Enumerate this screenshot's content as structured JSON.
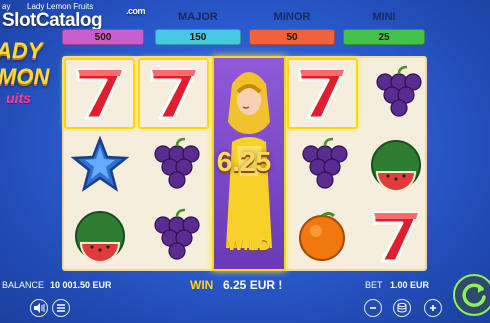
{
  "topbar": {
    "left_text": "ay",
    "game_title": "Lady Lemon Fruits"
  },
  "watermark": {
    "name": "SlotCatalog",
    "suffix": ".com"
  },
  "logo": {
    "line1": "ADY",
    "line2": "MON",
    "line3": "uits"
  },
  "jackpots": {
    "grand": {
      "label": "",
      "value": "500",
      "color": "#c85ed0"
    },
    "major": {
      "label": "MAJOR",
      "value": "150",
      "color": "#47c8e4"
    },
    "minor": {
      "label": "MINOR",
      "value": "50",
      "color": "#f0623c"
    },
    "mini": {
      "label": "MINI",
      "value": "25",
      "color": "#44c34c"
    }
  },
  "reels": [
    [
      "seven",
      "star",
      "watermelon"
    ],
    [
      "seven",
      "grapes",
      "grapes"
    ],
    [
      "wild",
      "wild",
      "wild"
    ],
    [
      "seven",
      "grapes",
      "orange"
    ],
    [
      "grapes",
      "watermelon",
      "seven"
    ]
  ],
  "wild_label": "WILD",
  "win_amount": "6.25",
  "bottom": {
    "balance_label": "BALANCE",
    "balance_value": "10 001.50 EUR",
    "win_label": "WIN",
    "win_value": "6.25 EUR !",
    "bet_label": "BET",
    "bet_value": "1.00 EUR"
  },
  "icons": [
    "sound-icon",
    "menu-icon",
    "minus-icon",
    "coin-stack-icon",
    "plus-icon",
    "spin-icon"
  ]
}
